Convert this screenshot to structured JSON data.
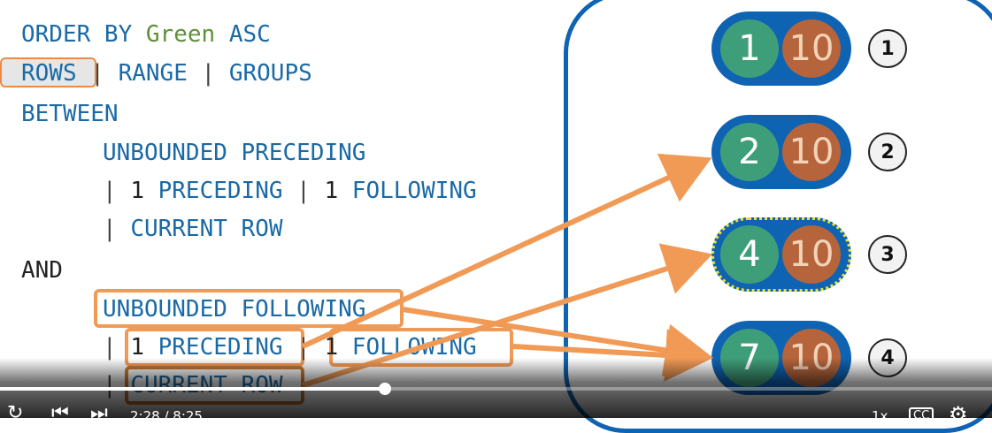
{
  "code": {
    "line1_a": "ORDER BY ",
    "line1_b": "Green",
    "line1_c": " ASC",
    "rows": "ROWS",
    "pipe": "|",
    "range": "RANGE",
    "groups": "GROUPS",
    "between": "BETWEEN",
    "unb_prec": "UNBOUNDED PRECEDING",
    "one": "1",
    "preceding": "PRECEDING",
    "following": "FOLLOWING",
    "current_row": "CURRENT ROW",
    "and": "AND",
    "unb_foll": "UNBOUNDED FOLLOWING"
  },
  "rows": [
    {
      "green": "1",
      "brown": "10",
      "label": "1"
    },
    {
      "green": "2",
      "brown": "10",
      "label": "2"
    },
    {
      "green": "4",
      "brown": "10",
      "label": "3"
    },
    {
      "green": "7",
      "brown": "10",
      "label": "4"
    }
  ],
  "player": {
    "time": "2:28 / 8:25",
    "progress": 0.388,
    "speed": "1x",
    "cc": "CC"
  },
  "colors": {
    "blue": "#0f63b3",
    "green": "#3f9e7a",
    "brown": "#b5643b",
    "orange": "#f19a56"
  }
}
